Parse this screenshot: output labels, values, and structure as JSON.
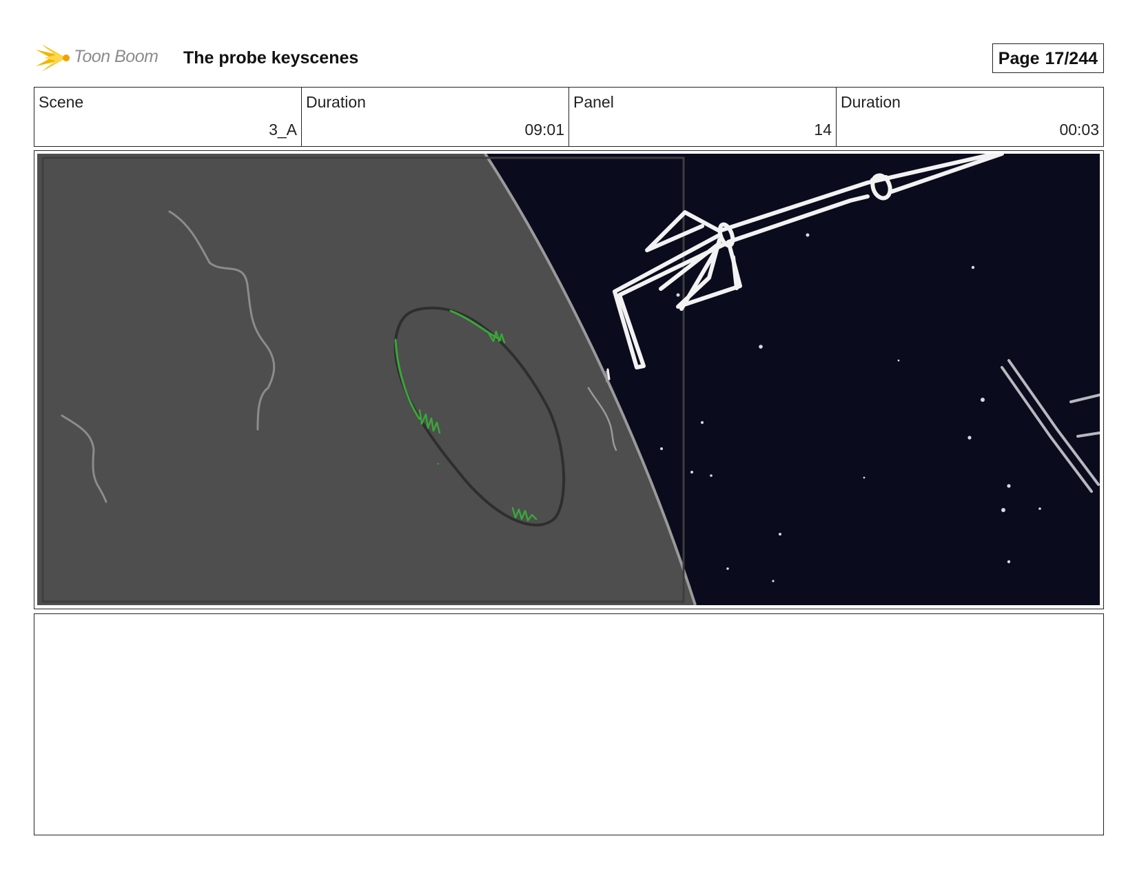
{
  "header": {
    "logo_text": "Toon Boom",
    "title": "The probe keyscenes",
    "page_label": "Page",
    "page_number": "17/244"
  },
  "info": {
    "scene_label": "Scene",
    "scene_value": "3_A",
    "scene_duration_label": "Duration",
    "scene_duration_value": "09:01",
    "panel_label": "Panel",
    "panel_value": "14",
    "panel_duration_label": "Duration",
    "panel_duration_value": "00:03"
  },
  "panel": {
    "planet_color": "#4e4e4e",
    "space_color": "#0b0b1e",
    "rim_color": "#9a9a9a",
    "sketch_green": "#3aa63a",
    "probe_sketch_color": "#f2f2f2"
  },
  "notes": {
    "text": ""
  }
}
